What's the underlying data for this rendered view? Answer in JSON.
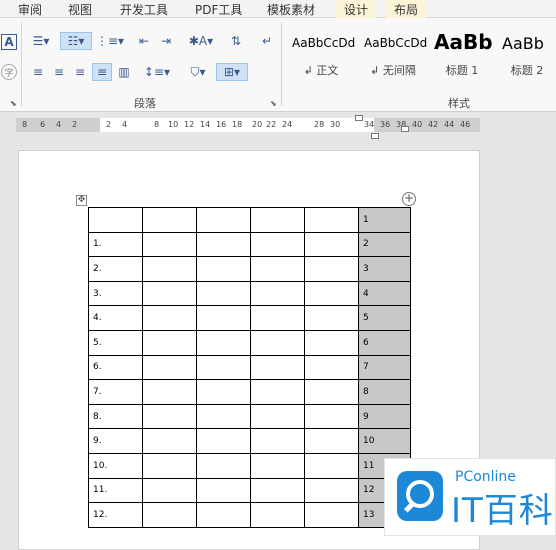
{
  "tabs": [
    "审阅",
    "视图",
    "开发工具",
    "PDF工具",
    "模板素材",
    "设计",
    "布局"
  ],
  "ribbon": {
    "paragraph_label": "段落",
    "styles_label": "样式",
    "left_icons": [
      "A",
      "字"
    ],
    "styles": [
      {
        "sample": "AaBbCcDd",
        "name": "↲ 正文"
      },
      {
        "sample": "AaBbCcDd",
        "name": "↲ 无间隔"
      },
      {
        "sample": "AaBb",
        "name": "标题 1"
      },
      {
        "sample": "AaBb",
        "name": "标题 2"
      }
    ]
  },
  "ruler_ticks": [
    "8",
    "6",
    "4",
    "2",
    "2",
    "4",
    "8",
    "10",
    "12",
    "14",
    "16",
    "18",
    "20",
    "22",
    "24",
    "28",
    "30",
    "34",
    "36",
    "38",
    "40",
    "42",
    "44",
    "46"
  ],
  "table": {
    "rows": [
      {
        "first": "",
        "last": "1"
      },
      {
        "first": "1.",
        "last": "2"
      },
      {
        "first": "2.",
        "last": "3"
      },
      {
        "first": "3.",
        "last": "4"
      },
      {
        "first": "4.",
        "last": "5"
      },
      {
        "first": "5.",
        "last": "6"
      },
      {
        "first": "6.",
        "last": "7"
      },
      {
        "first": "7.",
        "last": "8"
      },
      {
        "first": "8.",
        "last": "9"
      },
      {
        "first": "9.",
        "last": "10"
      },
      {
        "first": "10.",
        "last": "11"
      },
      {
        "first": "11.",
        "last": "12"
      },
      {
        "first": "12.",
        "last": "13"
      }
    ]
  },
  "watermark": {
    "brand": "PConline",
    "title": "IT百科"
  }
}
